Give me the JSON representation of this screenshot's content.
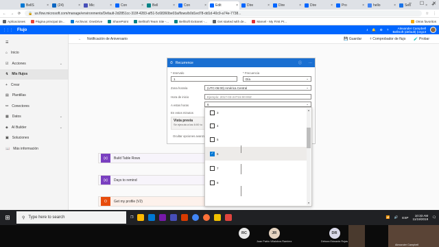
{
  "browser": {
    "tabs": [
      {
        "label": "BellS",
        "icon": "outlook-icon",
        "color": "#0078d4",
        "active": false
      },
      {
        "label": "(24)",
        "icon": "linkedin-icon",
        "color": "#0a66c2",
        "active": false
      },
      {
        "label": "Mic",
        "icon": "teams-icon",
        "color": "#464eb8",
        "active": false
      },
      {
        "label": "Con",
        "icon": "flow-icon",
        "color": "#0066ff",
        "active": false
      },
      {
        "label": "Bell",
        "icon": "sharepoint-icon",
        "color": "#038387",
        "active": false
      },
      {
        "label": "Con",
        "icon": "flow-icon",
        "color": "#0066ff",
        "active": false
      },
      {
        "label": "Edit",
        "icon": "flow-icon",
        "color": "#0066ff",
        "active": true
      },
      {
        "label": "Dire",
        "icon": "flow-icon",
        "color": "#0066ff",
        "active": false
      },
      {
        "label": "Dire",
        "icon": "flow-icon",
        "color": "#0066ff",
        "active": false
      },
      {
        "label": "Dire",
        "icon": "flow-icon",
        "color": "#0066ff",
        "active": false
      },
      {
        "label": "Pro",
        "icon": "flow-icon",
        "color": "#0066ff",
        "active": false
      },
      {
        "label": "hello",
        "icon": "google-icon",
        "color": "#4285f4",
        "active": false
      },
      {
        "label": "Sett",
        "icon": "settings-icon",
        "color": "#1a73e8",
        "active": false
      }
    ],
    "url": "us.flow.microsoft.com/manage/environments/Default-2d2851cc-319f-4283-af51-5c68360be03a/flows/b0d1ed78-dd1d-40c9-a74e-7738...",
    "bookmarks": [
      {
        "label": "Aplicaciones",
        "color": "#5f6368"
      },
      {
        "label": "Página principal de...",
        "color": "#ea4335"
      },
      {
        "label": "Archivos: OneDrive",
        "color": "#0078d4"
      },
      {
        "label": "SharePoint",
        "color": "#038387"
      },
      {
        "label": "BellSoft Team Site -...",
        "color": "#038387"
      },
      {
        "label": "BellSoft Extranet -...",
        "color": "#038387"
      },
      {
        "label": "Get started with de...",
        "color": "#5f6368"
      },
      {
        "label": "Marvel - My First Pr...",
        "color": "#e23237"
      },
      {
        "label": "Otros favoritos",
        "color": "#f9ab00"
      }
    ]
  },
  "app": {
    "name": "Flujo",
    "user_name": "Alexander Campbell",
    "user_env": "BellSoft (default) (org13"
  },
  "nav": [
    {
      "label": "Inicio",
      "icon": "home-icon",
      "chevron": false,
      "active": false
    },
    {
      "label": "Acciones",
      "icon": "checkbox-icon",
      "chevron": true,
      "active": false
    },
    {
      "label": "Mis flujos",
      "icon": "flow-icon",
      "chevron": false,
      "active": true
    },
    {
      "label": "Crear",
      "icon": "plus-icon",
      "chevron": false,
      "active": false
    },
    {
      "label": "Plantillas",
      "icon": "templates-icon",
      "chevron": false,
      "active": false
    },
    {
      "label": "Conectores",
      "icon": "connector-icon",
      "chevron": false,
      "active": false
    },
    {
      "label": "Datos",
      "icon": "data-icon",
      "chevron": true,
      "active": false
    },
    {
      "label": "AI Builder",
      "icon": "ai-builder-icon",
      "chevron": true,
      "active": false
    },
    {
      "label": "Soluciones",
      "icon": "solutions-icon",
      "chevron": false,
      "active": false
    },
    {
      "label": "Más información",
      "icon": "book-icon",
      "chevron": false,
      "active": false
    }
  ],
  "commandbar": {
    "breadcrumb": "Notificación de Aniversario",
    "save": "Guardar",
    "checker": "Comprobador de flujo",
    "test": "Probar"
  },
  "recurrence": {
    "title": "Recurrence",
    "interval_label": "* Intervalo",
    "interval_value": "1",
    "frequency_label": "* Frecuencia",
    "frequency_value": "Día",
    "timezone_label": "Zona horaria",
    "timezone_value": "(UTC-06:00) América Central",
    "start_label": "Hora de inicio",
    "start_value": "Ejemplo: 2017-03-24T15:00:00Z",
    "hours_label": "A estas horas",
    "hours_value": "6",
    "minutes_label": "En estos minutos",
    "preview_title": "Vista previa",
    "preview_text": "Se ejecuta a las 6:00 todo",
    "hide_advanced": "Ocultar opciones avanza"
  },
  "hour_options": [
    {
      "label": "3",
      "checked": false
    },
    {
      "label": "4",
      "checked": false
    },
    {
      "label": "5",
      "checked": false
    },
    {
      "label": "6",
      "checked": true
    },
    {
      "label": "7",
      "checked": false
    },
    {
      "label": "8",
      "checked": false
    }
  ],
  "actions": [
    {
      "label": "Build Table Rows",
      "icon_text": "{x}",
      "color": "#7a3fc0"
    },
    {
      "label": "Days to remind",
      "icon_text": "{x}",
      "color": "#7a3fc0"
    },
    {
      "label": "Get my profile (V2)",
      "icon_text": "O",
      "color": "#e74c0c"
    }
  ],
  "taskbar": {
    "search_placeholder": "Type here to search",
    "lang": "ESP",
    "time": "10:33 AM",
    "date": "11/19/2019"
  },
  "meeting": {
    "participants": [
      {
        "initials": "RC",
        "name": "",
        "color": "#e8e8e8"
      },
      {
        "initials": "JR",
        "name": "Juan Pablo Villalobos Ramirez",
        "color": "#e5d3c0"
      },
      {
        "initials": "DR",
        "name": "Débora Edwards Rojas",
        "color": "#d9d9e9"
      }
    ],
    "self_name": "Alexander Campbell"
  }
}
